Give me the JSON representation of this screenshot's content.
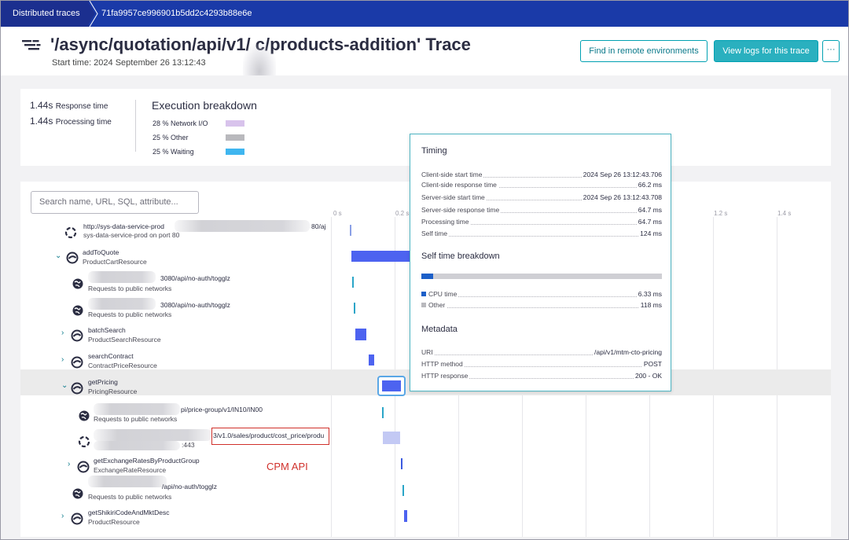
{
  "breadcrumb": {
    "root_label": "Distributed traces",
    "trace_id": "71fa9957ce996901b5dd2c4293b88e6e"
  },
  "header": {
    "title": "'/async/quotation/api/v1/    c/products-addition' Trace",
    "start_time": "Start time: 2024 September 26 13:12:43",
    "find_remote_label": "Find in remote environments",
    "view_logs_label": "View logs for this trace",
    "more_label": "···"
  },
  "summary": {
    "response_value": "1.44s",
    "response_label": "Response time",
    "processing_value": "1.44s",
    "processing_label": "Processing time",
    "breakdown_title": "Execution breakdown",
    "breakdown": [
      {
        "label": "28 % Network I/O",
        "color": "#d8c3ec"
      },
      {
        "label": "25 % Other",
        "color": "#b9b9bd"
      },
      {
        "label": "25 % Waiting",
        "color": "#3fb6f0"
      }
    ]
  },
  "tree": {
    "search_placeholder": "Search name, URL, SQL, attribute...",
    "axis_labels": [
      "0 s",
      "0.2 s",
      "1.2 s",
      "1.4 s"
    ],
    "nodes": [
      {
        "name": "http://sys-data-service-prod",
        "name_tail": "80/aj",
        "sub": "sys-data-service-prod on port 80"
      },
      {
        "name": "addToQuote",
        "sub": "ProductCartResource"
      },
      {
        "name": "3080/api/no-auth/togglz",
        "sub": "Requests to public networks"
      },
      {
        "name": "3080/api/no-auth/togglz",
        "sub": "Requests to public networks"
      },
      {
        "name": "batchSearch",
        "sub": "ProductSearchResource"
      },
      {
        "name": "searchContract",
        "sub": "ContractPriceResource"
      },
      {
        "name": "getPricing",
        "sub": "PricingResource"
      },
      {
        "name": "pi/price-group/v1/IN10/IN00",
        "sub": "Requests to public networks"
      },
      {
        "name": "3/v1.0/sales/product/cost_price/produ",
        "sub": ":443"
      },
      {
        "name": "getExchangeRatesByProductGroup",
        "sub": "ExchangeRateResource"
      },
      {
        "name": "/api/no-auth/togglz",
        "sub": "Requests to public networks"
      },
      {
        "name": "getShikiriCodeAndMktDesc",
        "sub": "ProductResource"
      }
    ],
    "callout_label": "CPM API"
  },
  "popup": {
    "timing_title": "Timing",
    "timing": [
      {
        "k": "Client-side start time",
        "v": "2024 Sep 26 13:12:43.706"
      },
      {
        "k": "Client-side response time",
        "v": "66.2 ms"
      },
      {
        "k": "Server-side start time",
        "v": "2024 Sep 26 13:12:43.708"
      },
      {
        "k": "Server-side response time",
        "v": "64.7 ms"
      },
      {
        "k": "Processing time",
        "v": "64.7 ms"
      },
      {
        "k": "Self time",
        "v": "124 ms"
      }
    ],
    "self_title": "Self time breakdown",
    "self_cpu_fraction": 0.05,
    "self_rows": [
      {
        "k": "CPU time",
        "v": "6.33 ms",
        "color": "#1c5fc8"
      },
      {
        "k": "Other",
        "v": "118 ms",
        "color": "#b9b9bd"
      }
    ],
    "meta_title": "Metadata",
    "meta": [
      {
        "k": "URI",
        "v": "/api/v1/mtm-cto-pricing"
      },
      {
        "k": "HTTP method",
        "v": "POST"
      },
      {
        "k": "HTTP response",
        "v": "200 - OK"
      }
    ]
  }
}
